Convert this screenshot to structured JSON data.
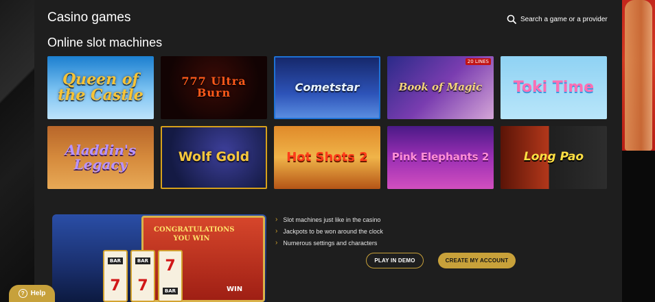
{
  "header": {
    "title": "Casino games",
    "search_label": "Search a game or a provider"
  },
  "section": {
    "title": "Online slot machines"
  },
  "games": [
    {
      "name": "Queen of the Castle"
    },
    {
      "name": "777 Ultra Burn"
    },
    {
      "name": "Cometstar"
    },
    {
      "name": "Book of Magic",
      "badge": "20 LINES"
    },
    {
      "name": "Toki Time"
    },
    {
      "name": "Aladdin's Legacy"
    },
    {
      "name": "Wolf Gold"
    },
    {
      "name": "Hot Shots 2"
    },
    {
      "name": "Pink Elephants 2"
    },
    {
      "name": "Long Pao"
    }
  ],
  "promo": {
    "win_text": "CONGRATULATIONS YOU WIN",
    "win_label": "WIN",
    "reel_symbol": "7",
    "reel_bar": "BAR"
  },
  "features": [
    "Slot machines just like in the casino",
    "Jackpots to be won around the clock",
    "Numerous settings and characters"
  ],
  "buttons": {
    "demo": "PLAY IN DEMO",
    "create": "CREATE MY ACCOUNT"
  },
  "help": {
    "label": "Help"
  },
  "colors": {
    "accent": "#c8a13a",
    "panel": "#1e1e1e",
    "background": "#0b0b0b"
  }
}
